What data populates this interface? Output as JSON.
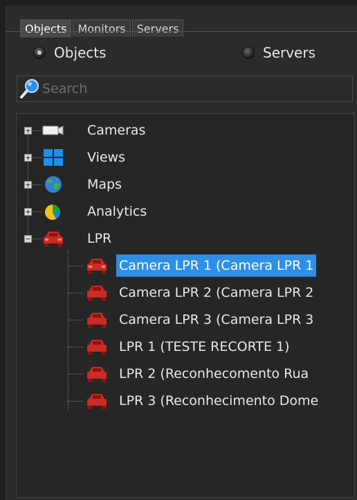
{
  "tabs": [
    {
      "label": "Objects",
      "active": true
    },
    {
      "label": "Monitors",
      "active": false
    },
    {
      "label": "Servers",
      "active": false
    }
  ],
  "radio": {
    "objects_label": "Objects",
    "servers_label": "Servers",
    "selected": "Objects"
  },
  "search": {
    "placeholder": "Search",
    "value": ""
  },
  "tree": {
    "roots": [
      {
        "label": "Cameras",
        "icon": "camera-icon",
        "expanded": false
      },
      {
        "label": "Views",
        "icon": "views-grid-icon",
        "expanded": false
      },
      {
        "label": "Maps",
        "icon": "globe-icon",
        "expanded": false
      },
      {
        "label": "Analytics",
        "icon": "pie-chart-icon",
        "expanded": false
      },
      {
        "label": "LPR",
        "icon": "car-icon",
        "expanded": true
      }
    ],
    "lpr_children": [
      {
        "label": "Camera LPR 1 (Camera LPR 1",
        "icon": "car-icon",
        "selected": true
      },
      {
        "label": "Camera LPR 2 (Camera LPR 2",
        "icon": "car-icon",
        "selected": false
      },
      {
        "label": "Camera LPR 3 (Camera LPR 3",
        "icon": "car-icon",
        "selected": false
      },
      {
        "label": "LPR 1 (TESTE RECORTE 1)",
        "icon": "car-icon",
        "selected": false
      },
      {
        "label": "LPR 2 (Reconhecomento Rua",
        "icon": "car-icon",
        "selected": false
      },
      {
        "label": "LPR 3 (Reconhecimento Dome",
        "icon": "car-icon",
        "selected": false
      }
    ]
  },
  "colors": {
    "selection": "#2f8fe6",
    "car_red": "#cc2a24",
    "background": "#2b2b2b"
  }
}
